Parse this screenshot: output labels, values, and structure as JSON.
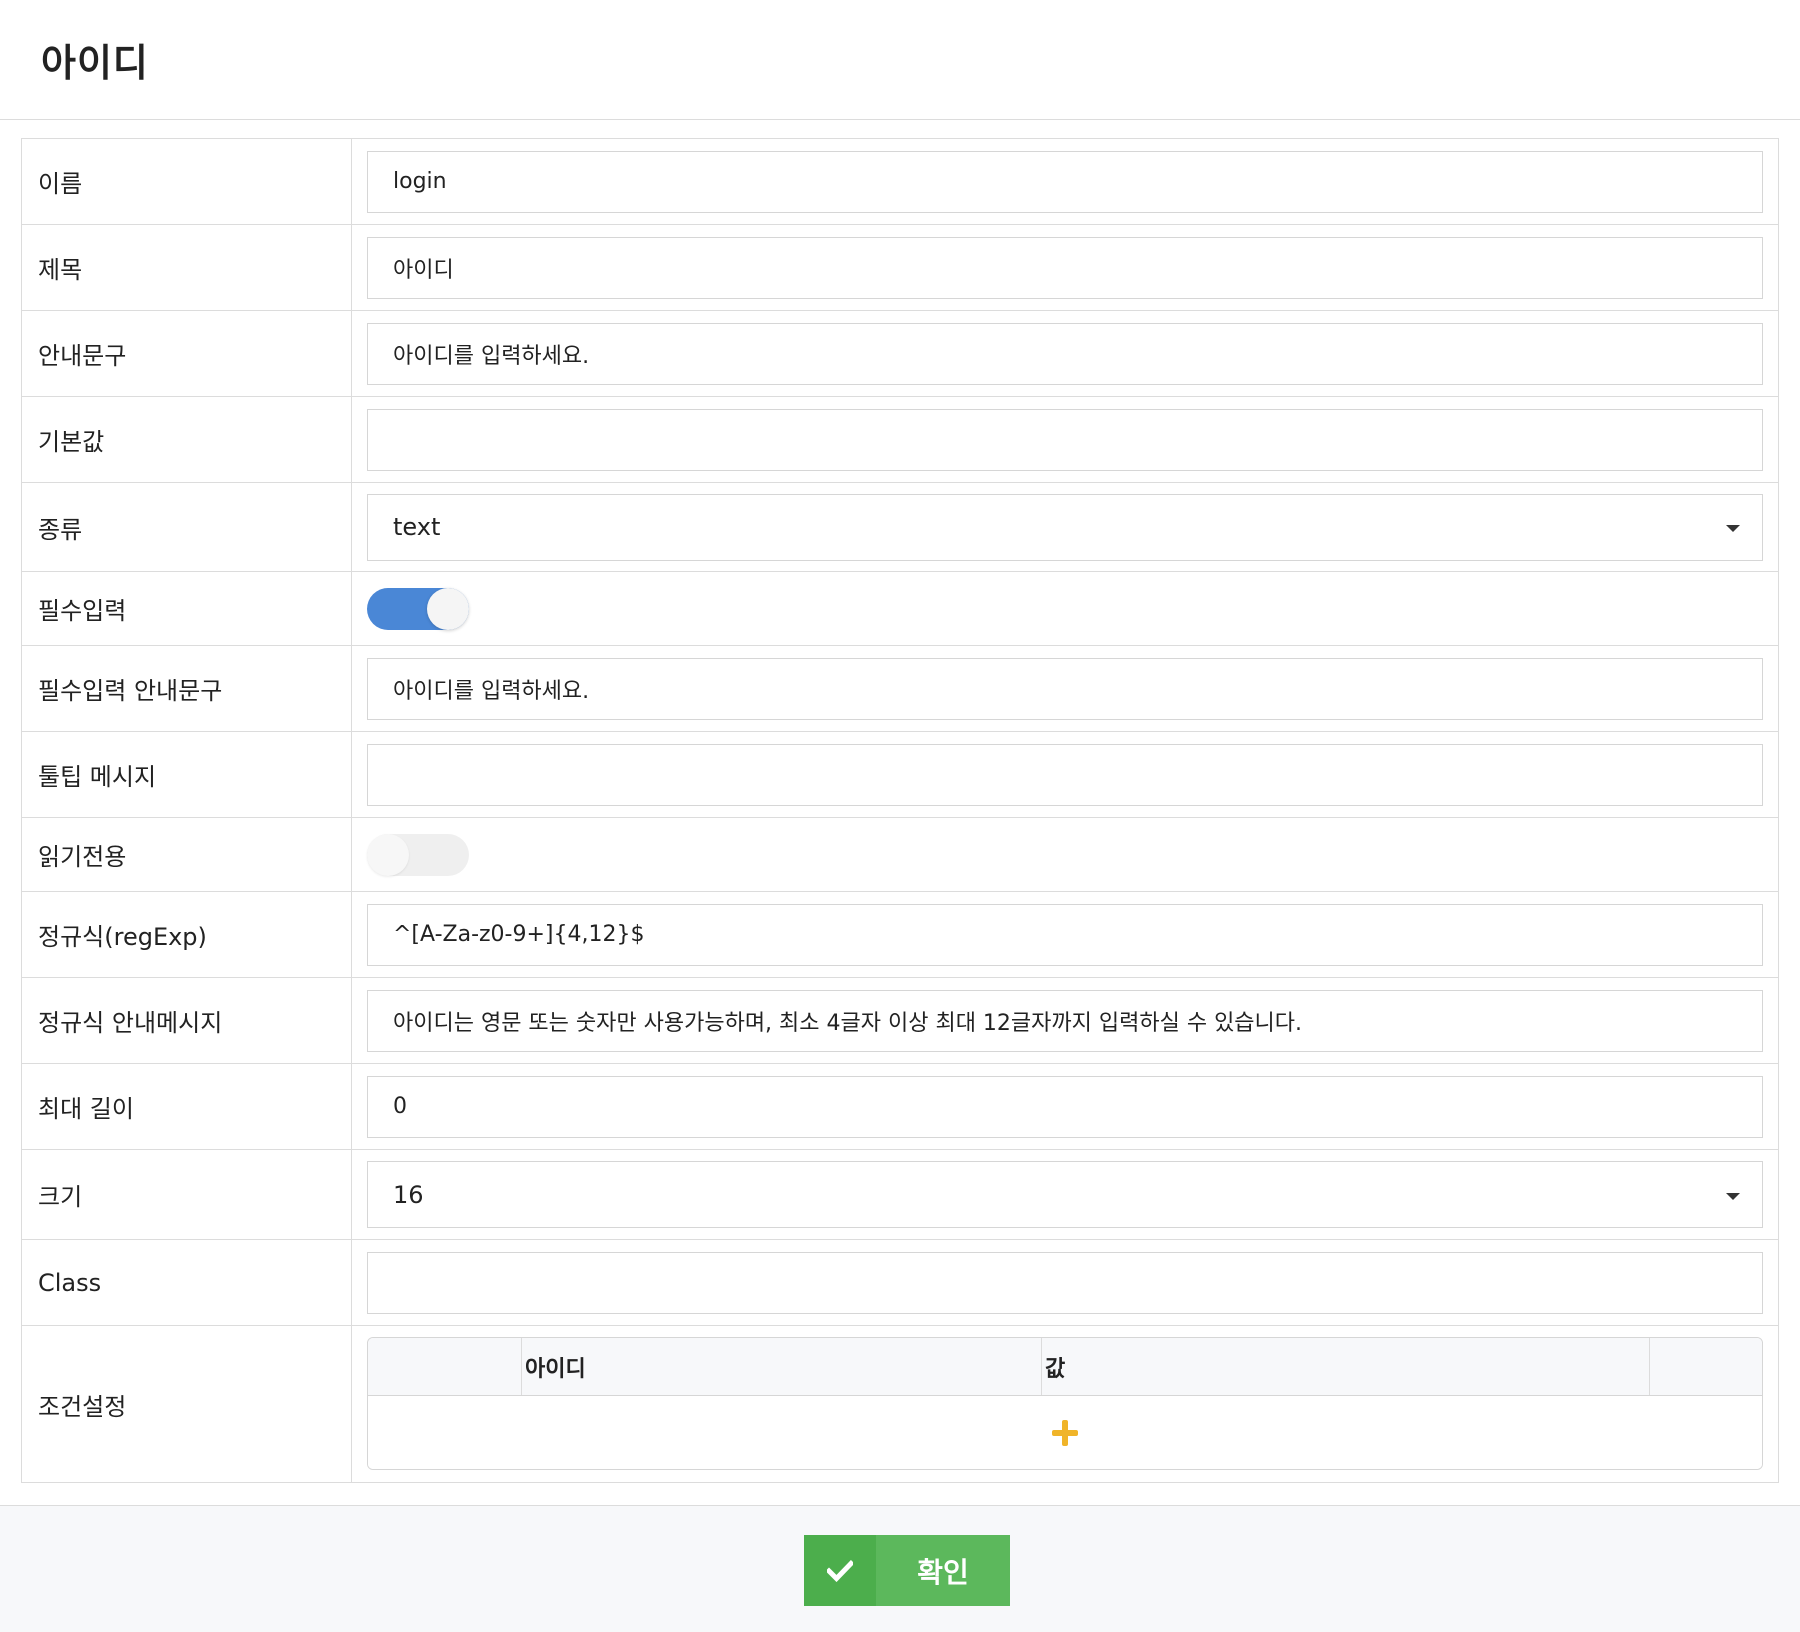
{
  "modal": {
    "title": "아이디"
  },
  "fields": {
    "name": {
      "label": "이름",
      "value": "login"
    },
    "title": {
      "label": "제목",
      "value": "아이디"
    },
    "guide": {
      "label": "안내문구",
      "value": "아이디를 입력하세요."
    },
    "default": {
      "label": "기본값",
      "value": ""
    },
    "type": {
      "label": "종류",
      "value": "text"
    },
    "required": {
      "label": "필수입력",
      "checked": true
    },
    "required_guide": {
      "label": "필수입력 안내문구",
      "value": "아이디를 입력하세요."
    },
    "tooltip": {
      "label": "툴팁 메시지",
      "value": ""
    },
    "readonly": {
      "label": "읽기전용",
      "checked": false
    },
    "regexp": {
      "label": "정규식(regExp)",
      "value": "^[A-Za-z0-9+]{4,12}$"
    },
    "regexp_message": {
      "label": "정규식 안내메시지",
      "value": "아이디는 영문 또는 숫자만 사용가능하며, 최소 4글자 이상 최대 12글자까지 입력하실 수 있습니다."
    },
    "max_length": {
      "label": "최대 길이",
      "value": "0"
    },
    "size": {
      "label": "크기",
      "value": "16"
    },
    "class": {
      "label": "Class",
      "value": ""
    },
    "conditions": {
      "label": "조건설정",
      "columns": [
        "",
        "아이디",
        "값",
        ""
      ],
      "rows": []
    }
  },
  "icons": {
    "select_caret": "caret-down-icon",
    "add": "plus-icon",
    "confirm": "check-icon"
  },
  "footer": {
    "confirm_label": "확인"
  },
  "colors": {
    "toggle_on": "#4a87d6",
    "confirm_bg": "#5cb85c",
    "plus_icon": "#f0b429"
  }
}
